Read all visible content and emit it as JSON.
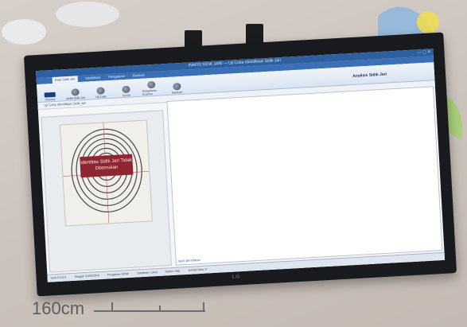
{
  "app": {
    "title": "INAFIS SIDIK JARI — Uji Coba Identifikasi Sidik Jari",
    "tabs": [
      "Data Sidik Jari",
      "Identifikasi",
      "Pengaturan",
      "Bantuan"
    ],
    "active_tab": "Data Sidik Jari",
    "ribbon_buttons": [
      "Koneksi",
      "Ambil Sidik Jari",
      "Uji Coba",
      "Cocok",
      "Pengaturan Scanner",
      "Bantuan"
    ],
    "right_heading": "Analisis Sidik Jari",
    "subtitle": "Uji Coba Identifikasi Sidik Jari",
    "result_text": "Identitas Sidik Jari Tidak Ditemukan",
    "right_link": "hasil identifikasi",
    "status": [
      "Versi 5.0.0.0",
      "Tanggal: 01/06/2018",
      "Pengguna: Admin",
      "Database: Lokal",
      "Status: Siap",
      "Jumlah Data: 0"
    ]
  },
  "monitor_brand": "LG",
  "height_marker": "160cm",
  "colors": {
    "titlebar": "#2e5fa0",
    "result_badge": "#8f2530",
    "monitor_bezel": "#181a1d"
  }
}
